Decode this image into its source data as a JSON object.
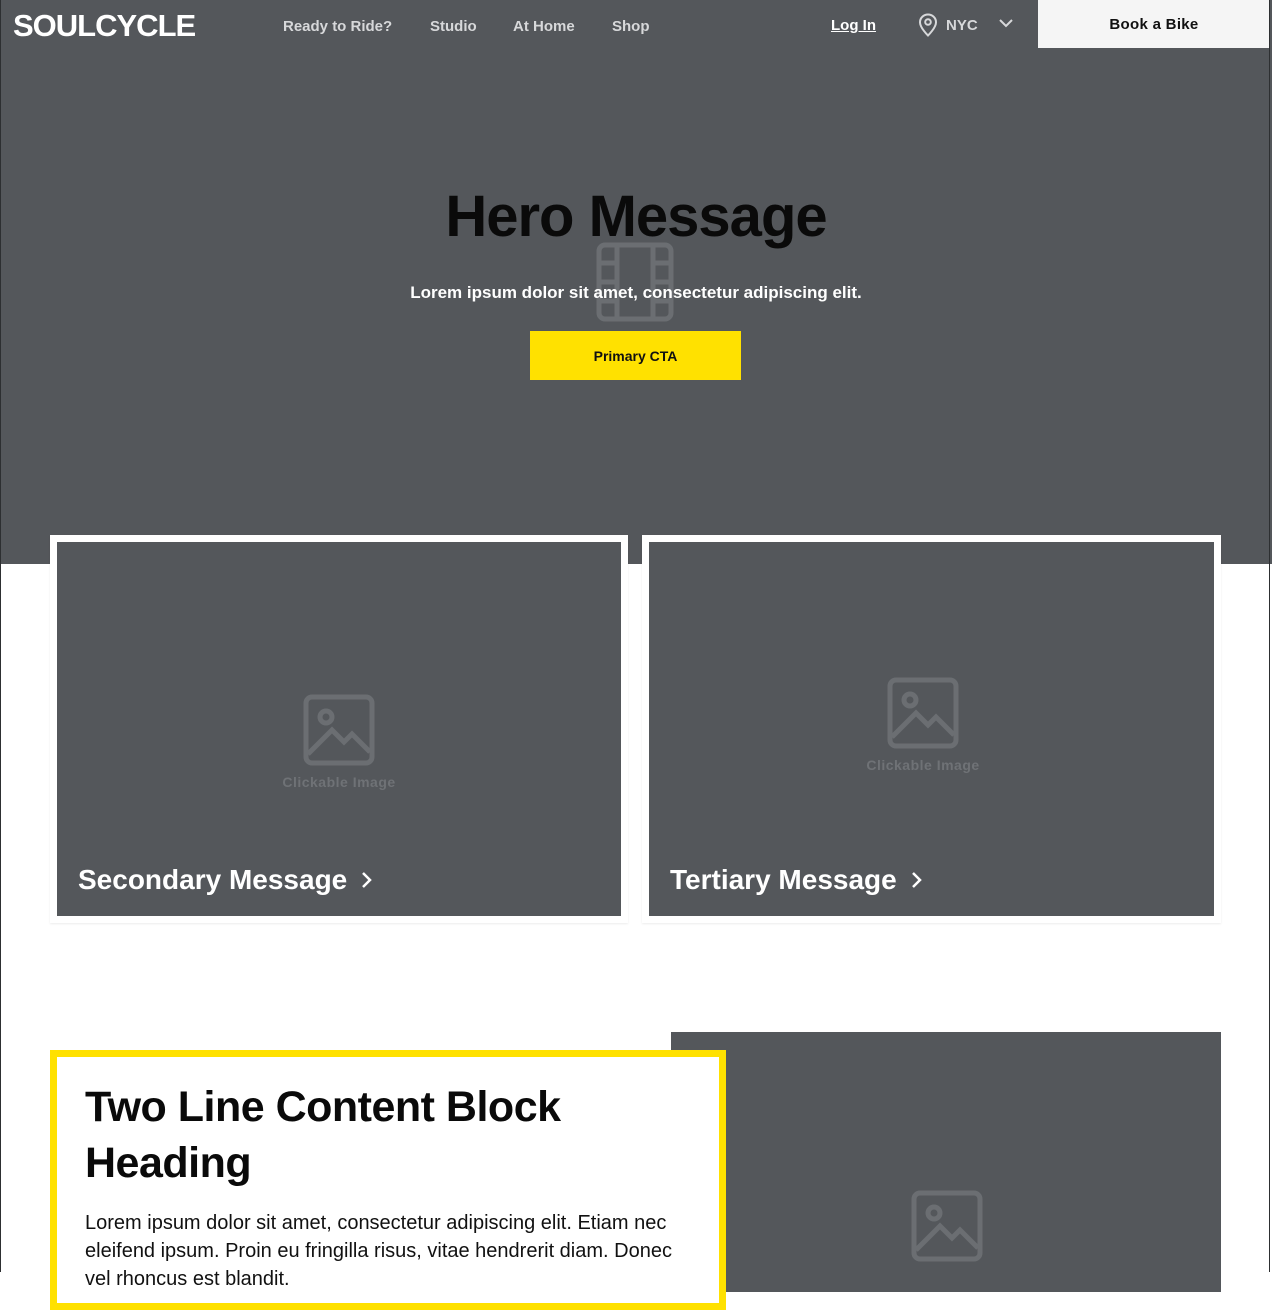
{
  "nav": {
    "logo": "SOULCYCLE",
    "links": [
      "Ready to Ride?",
      "Studio",
      "At Home",
      "Shop"
    ],
    "login": "Log In",
    "location": "NYC",
    "book_button": "Book a Bike"
  },
  "hero": {
    "title": "Hero Message",
    "subtitle": "Lorem ipsum dolor sit amet, consectetur adipiscing elit.",
    "cta": "Primary CTA",
    "media_icon": "film-icon"
  },
  "cards": [
    {
      "image_caption": "Clickable Image",
      "message": "Secondary Message",
      "icon": "chevron-right-icon"
    },
    {
      "image_caption": "Clickable Image",
      "message": "Tertiary Message",
      "icon": "chevron-right-icon"
    }
  ],
  "content_block": {
    "heading": "Two Line Content Block Heading",
    "body": "Lorem ipsum dolor sit amet, consectetur adipiscing elit. Etiam nec eleifend ipsum. Proin eu fringilla risus, vitae hendrerit diam. Donec vel rhoncus est blandit."
  },
  "colors": {
    "placeholder_gray": "#54575b",
    "accent_yellow": "#ffe100",
    "book_button_bg": "#f5f5f5"
  }
}
